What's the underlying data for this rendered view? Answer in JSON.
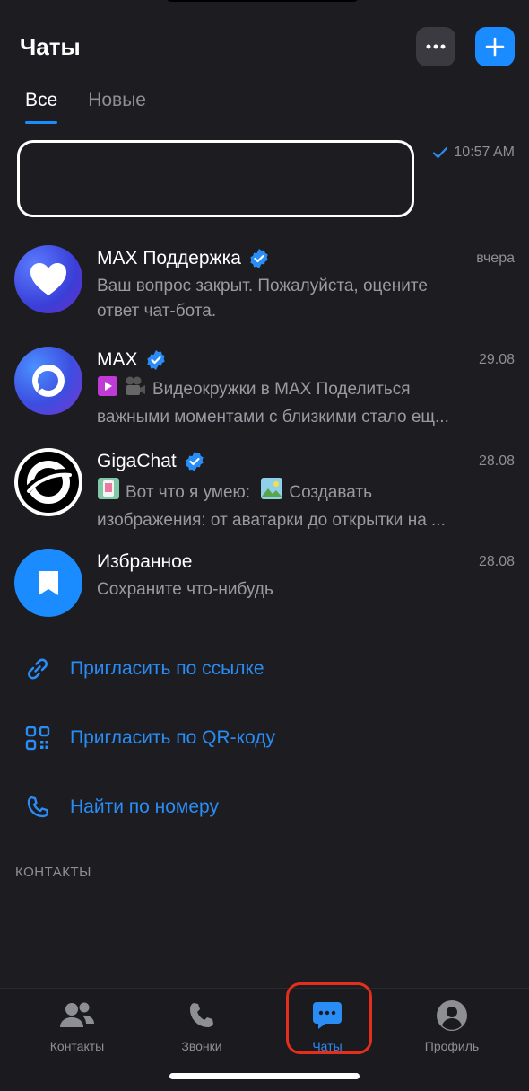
{
  "header": {
    "title": "Чаты"
  },
  "tabs": [
    {
      "label": "Все",
      "active": true
    },
    {
      "label": "Новые",
      "active": false
    }
  ],
  "first_chat": {
    "time": "10:57 AM"
  },
  "chats": [
    {
      "name": "MAX Поддержка",
      "time": "вчера",
      "line1": "Ваш вопрос закрыт. Пожалуйста, оцените",
      "line2": "ответ чат-бота."
    },
    {
      "name": "MAX",
      "time": "29.08",
      "line1": "Видеокружки в MAX Поделиться",
      "line2": "важными моментами с близкими стало ещ..."
    },
    {
      "name": "GigaChat",
      "time": "28.08",
      "line1": "Вот что я умею:",
      "line1b": "Создавать",
      "line2": "изображения: от аватарки до открытки на ..."
    },
    {
      "name": "Избранное",
      "time": "28.08",
      "line1": "Сохраните что-нибудь"
    }
  ],
  "actions": [
    {
      "label": "Пригласить по ссылке",
      "icon": "link-icon"
    },
    {
      "label": "Пригласить по QR-коду",
      "icon": "qr-code-icon"
    },
    {
      "label": "Найти по номеру",
      "icon": "phone-icon"
    }
  ],
  "section_title": "КОНТАКТЫ",
  "tabbar": [
    {
      "label": "Контакты",
      "icon": "contacts-icon"
    },
    {
      "label": "Звонки",
      "icon": "phone-icon"
    },
    {
      "label": "Чаты",
      "icon": "chat-bubble-icon",
      "active": true
    },
    {
      "label": "Профиль",
      "icon": "profile-icon"
    }
  ],
  "colors": {
    "accent": "#1a8cff",
    "background": "#1c1c21",
    "highlight": "#e52e1c"
  }
}
